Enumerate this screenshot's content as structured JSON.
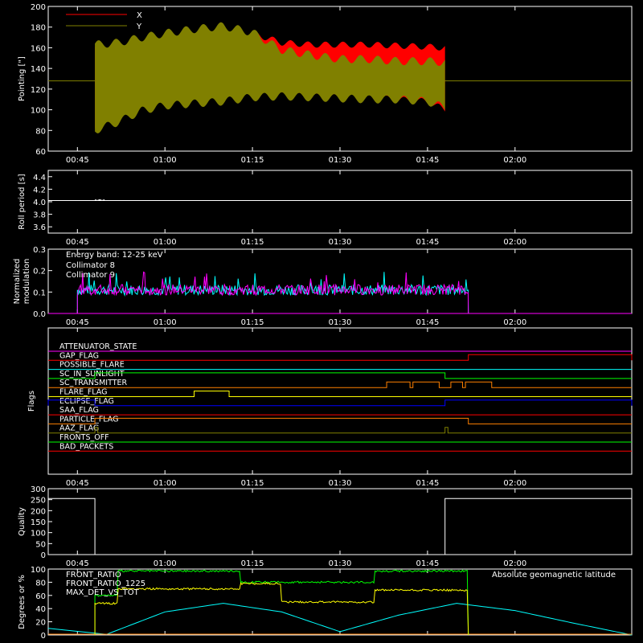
{
  "time_ticks": [
    "00:45",
    "01:00",
    "01:15",
    "01:30",
    "01:45",
    "02:00"
  ],
  "chart_data": [
    {
      "type": "line",
      "ylabel": "Pointing [\"]",
      "ylim": [
        60,
        200
      ],
      "yticks": [
        "60",
        "80",
        "100",
        "120",
        "140",
        "160",
        "180",
        "200"
      ],
      "series": [
        {
          "name": "X",
          "color": "#ff0000"
        },
        {
          "name": "Y",
          "color": "#808000"
        }
      ],
      "reference_level": 128,
      "data_start": "00:48",
      "data_end": "01:48",
      "x_envelope": {
        "t": [
          "00:48",
          "00:52",
          "00:56",
          "01:00",
          "01:05",
          "01:10",
          "01:15",
          "01:20",
          "01:25",
          "01:30",
          "01:35",
          "01:40",
          "01:45",
          "01:48"
        ],
        "x_upper": [
          160,
          157,
          167,
          171,
          175,
          177,
          174,
          165,
          163,
          163,
          163,
          162,
          161,
          160
        ],
        "x_lower": [
          83,
          90,
          107,
          110,
          119,
          117,
          118,
          114,
          113,
          112,
          112,
          110,
          108,
          100
        ],
        "y_upper": [
          163,
          165,
          170,
          174,
          178,
          181,
          175,
          158,
          153,
          149,
          149,
          147,
          147,
          146
        ],
        "y_lower": [
          80,
          88,
          99,
          104,
          106,
          108,
          112,
          113,
          112,
          111,
          110,
          110,
          108,
          102
        ]
      }
    },
    {
      "type": "line",
      "ylabel": "Roll period [s]",
      "ylim": [
        3.5,
        4.5
      ],
      "yticks": [
        "3.6",
        "3.8",
        "4.0",
        "4.2",
        "4.4"
      ],
      "series": [
        {
          "name": "",
          "color": "#ffffff",
          "value": 4.02
        }
      ]
    },
    {
      "type": "line",
      "ylabel": "Normalized modulation",
      "ylim": [
        0,
        0.3
      ],
      "yticks": [
        "0.0",
        "0.1",
        "0.2",
        "0.3"
      ],
      "annotation": "Energy band: 12-25 keV",
      "series": [
        {
          "name": "Collimator 8",
          "color": "#00ffff",
          "mean": 0.11
        },
        {
          "name": "Collimator 9",
          "color": "#ff00ff",
          "mean": 0.11
        }
      ],
      "data_start": "00:45",
      "data_end": "01:52"
    },
    {
      "type": "line",
      "ylabel": "Flags",
      "flags": [
        {
          "name": "ATTENUATOR_STATE",
          "color": "#ff00ff"
        },
        {
          "name": "GAP_FLAG",
          "color": "#ff0000"
        },
        {
          "name": "POSSIBLE_FLARE",
          "color": "#00ffff"
        },
        {
          "name": "SC_IN_SUNLIGHT",
          "color": "#00ff00"
        },
        {
          "name": "SC_TRANSMITTER",
          "color": "#ff8000"
        },
        {
          "name": "FLARE_FLAG",
          "color": "#ffff00"
        },
        {
          "name": "ECLIPSE_FLAG",
          "color": "#0000ff"
        },
        {
          "name": "SAA_FLAG",
          "color": "#ff0000"
        },
        {
          "name": "PARTICLE_FLAG",
          "color": "#ff8000"
        },
        {
          "name": "AAZ_FLAG",
          "color": "#808000"
        },
        {
          "name": "FRONTS_OFF",
          "color": "#00ff00"
        },
        {
          "name": "BAD_PACKETS",
          "color": "#ff0000"
        }
      ],
      "intervals": {
        "GAP_FLAG": [
          [
            "01:52",
            "02:20"
          ]
        ],
        "SC_IN_SUNLIGHT": [
          [
            "00:48",
            "01:48"
          ]
        ],
        "SC_TRANSMITTER": [
          [
            "01:38",
            "01:42"
          ],
          [
            "01:42.5",
            "01:47"
          ],
          [
            "01:49",
            "01:51"
          ],
          [
            "01:51.5",
            "01:56"
          ]
        ],
        "FLARE_FLAG": [
          [
            "01:05",
            "01:11"
          ]
        ],
        "ECLIPSE_FLAG": [
          [
            "00:40",
            "00:48"
          ],
          [
            "01:48",
            "02:20"
          ]
        ],
        "PARTICLE_FLAG": [
          [
            "00:48",
            "01:52"
          ]
        ],
        "AAZ_FLAG": [
          [
            "00:48",
            "00:48.5"
          ],
          [
            "01:48",
            "01:48.5"
          ]
        ]
      }
    },
    {
      "type": "line",
      "ylabel": "Quality",
      "ylim": [
        0,
        300
      ],
      "yticks": [
        "0",
        "50",
        "100",
        "150",
        "200",
        "250",
        "300"
      ],
      "series": [
        {
          "name": "",
          "color": "#ffffff"
        }
      ],
      "segments": [
        {
          "t": [
            "00:40",
            "00:48"
          ],
          "value": 255
        },
        {
          "t": [
            "00:48",
            "01:48"
          ],
          "value": 0
        },
        {
          "t": [
            "01:48",
            "02:20"
          ],
          "value": 255
        }
      ]
    },
    {
      "type": "line",
      "ylabel": "Degrees or %",
      "ylim": [
        0,
        100
      ],
      "yticks": [
        "0",
        "20",
        "40",
        "60",
        "80",
        "100"
      ],
      "annotation": "Absolute geomagnetic latitude",
      "series": [
        {
          "name": "FRONT_RATIO",
          "color": "#ffff00"
        },
        {
          "name": "FRONT_RATIO_1225",
          "color": "#00ff00"
        },
        {
          "name": "MAX_DET_VS_TOT",
          "color": "#ff8000"
        }
      ],
      "front_ratio": [
        {
          "t": [
            "00:48",
            "00:52"
          ],
          "value": 48
        },
        {
          "t": [
            "00:52",
            "01:13"
          ],
          "value": 70
        },
        {
          "t": [
            "01:13",
            "01:20"
          ],
          "value": 78
        },
        {
          "t": [
            "01:20",
            "01:36"
          ],
          "value": 50
        },
        {
          "t": [
            "01:36",
            "01:52"
          ],
          "value": 68
        }
      ],
      "front_ratio_1225": [
        {
          "t": [
            "00:48",
            "00:52"
          ],
          "value": 60
        },
        {
          "t": [
            "00:52",
            "01:13"
          ],
          "value": 97
        },
        {
          "t": [
            "01:13",
            "01:36"
          ],
          "value": 80
        },
        {
          "t": [
            "01:36",
            "01:52"
          ],
          "value": 97
        }
      ],
      "latitude": {
        "t": [
          "00:40",
          "00:50",
          "01:00",
          "01:10",
          "01:20",
          "01:30",
          "01:40",
          "01:50",
          "02:00",
          "02:10",
          "02:20"
        ],
        "values": [
          10,
          1,
          35,
          48,
          35,
          5,
          30,
          48,
          37,
          18,
          0
        ]
      }
    }
  ]
}
